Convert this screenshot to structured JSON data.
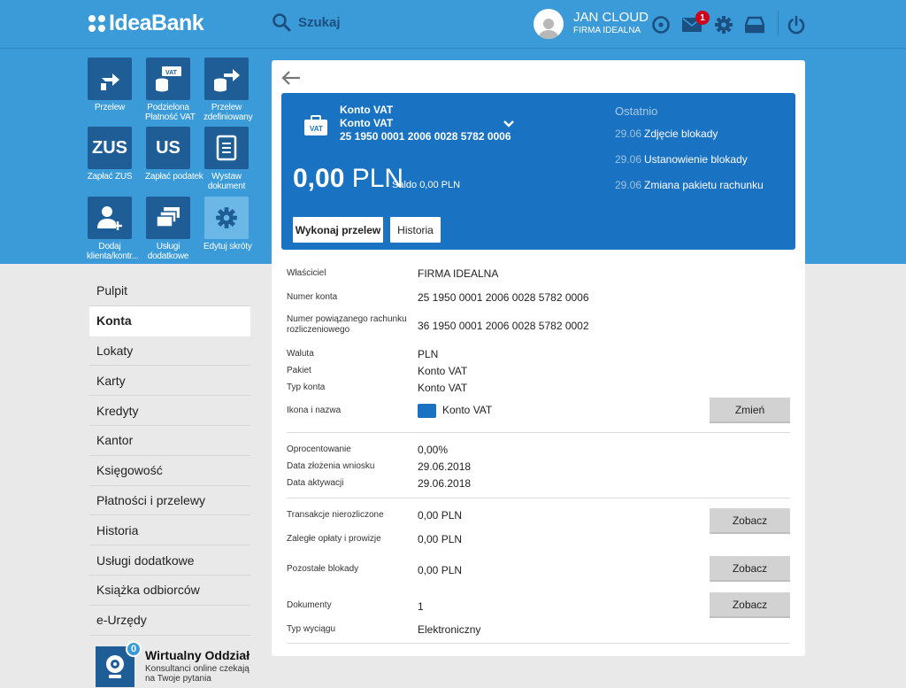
{
  "brand": {
    "name": "IdeaBank"
  },
  "header": {
    "search_label": "Szukaj",
    "user_name": "JAN CLOUD",
    "company": "FIRMA IDEALNA",
    "messages_count": "1"
  },
  "shortcuts": [
    {
      "label": "Przelew",
      "icon": "arrow-hand-icon"
    },
    {
      "label": "Podzielona Płatność VAT",
      "icon": "vat-split-icon"
    },
    {
      "label": "Przelew zdefiniowany",
      "icon": "coins-arrow-icon"
    },
    {
      "label": "Zapłać ZUS",
      "icon": "zus-icon",
      "text": "ZUS"
    },
    {
      "label": "Zapłać podatek",
      "icon": "us-icon",
      "text": "US"
    },
    {
      "label": "Wystaw dokument",
      "icon": "document-icon"
    },
    {
      "label": "Dodaj klienta/kontr...",
      "icon": "add-user-icon"
    },
    {
      "label": "Usługi dodatkowe",
      "icon": "cards-icon"
    },
    {
      "label": "Edytuj skróty",
      "icon": "gear-icon"
    }
  ],
  "nav": [
    "Pulpit",
    "Konta",
    "Lokaty",
    "Karty",
    "Kredyty",
    "Kantor",
    "Księgowość",
    "Płatności i przelewy",
    "Historia",
    "Usługi dodatkowe",
    "Książka odbiorców",
    "e-Urzędy"
  ],
  "virtual_office": {
    "badge": "0",
    "title": "Wirtualny Oddział",
    "subtitle_line1": "Konsultanci online czekają",
    "subtitle_line2": "na Twoje pytania"
  },
  "account": {
    "name1": "Konto VAT",
    "name2": "Konto VAT",
    "number": "25 1950 0001 2006 0028 5782 0006",
    "balance": "0,00",
    "currency": "PLN",
    "saldo": "Saldo 0,00 PLN",
    "btn_transfer": "Wykonaj przelew",
    "btn_history": "Historia",
    "recent_title": "Ostatnio",
    "recent": [
      {
        "date": "29.06",
        "text": "Zdjęcie blokady"
      },
      {
        "date": "29.06",
        "text": "Ustanowienie blokady"
      },
      {
        "date": "29.06",
        "text": "Zmiana pakietu rachunku"
      }
    ]
  },
  "details": {
    "owner_label": "Właściciel",
    "owner": "FIRMA IDEALNA",
    "number_label": "Numer konta",
    "number": "25 1950 0001 2006 0028 5782 0006",
    "linked_label1": "Numer powiązanego rachunku",
    "linked_label2": "rozliczeniowego",
    "linked": "36 1950 0001 2006 0028 5782 0002",
    "currency_label": "Waluta",
    "currency": "PLN",
    "package_label": "Pakiet",
    "package": "Konto VAT",
    "type_label": "Typ konta",
    "type": "Konto VAT",
    "icon_label": "Ikona i nazwa",
    "icon_name": "Konto VAT",
    "change_btn": "Zmień",
    "interest_label": "Oprocentowanie",
    "interest": "0,00%",
    "app_date_label": "Data złożenia wniosku",
    "app_date": "29.06.2018",
    "act_date_label": "Data aktywacji",
    "act_date": "29.06.2018",
    "unsettled_label": "Transakcje nierozliczone",
    "unsettled": "0,00 PLN",
    "overdue_label": "Zaległe opłaty i prowizje",
    "overdue": "0,00 PLN",
    "blocks_label": "Pozostałe blokady",
    "blocks": "0,00 PLN",
    "docs_label": "Dokumenty",
    "docs": "1",
    "statement_label": "Typ wyciągu",
    "statement": "Elektroniczny",
    "view_btn": "Zobacz"
  }
}
